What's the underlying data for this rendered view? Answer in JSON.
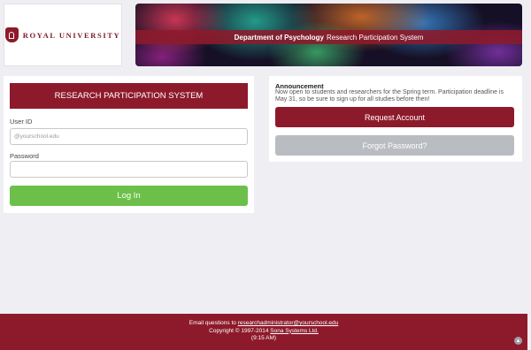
{
  "brand": {
    "logo_text": "ROYAL UNIVERSITY",
    "colors": {
      "primary": "#8d1a2b",
      "success": "#6cc04a",
      "muted": "#b9bcc1"
    }
  },
  "banner": {
    "department": "Department of Psychology",
    "system": "Research Participation System"
  },
  "login": {
    "header": "RESEARCH PARTICIPATION SYSTEM",
    "user_id_label": "User ID",
    "user_id_placeholder": "@yourschool.edu",
    "user_id_value": "",
    "password_label": "Password",
    "password_value": "",
    "login_button": "Log In"
  },
  "announcement": {
    "title": "Announcement",
    "body": "Now open to students and researchers for the Spring term. Participation deadline is May 31, so be sure to sign up for all studies before then!",
    "request_button": "Request Account",
    "forgot_button": "Forgot Password?"
  },
  "footer": {
    "email_prefix": "Email questions to ",
    "email": "researchadministrator@yourschool.edu",
    "copyright_prefix": "Copyright © 1997-2014 ",
    "company": "Sona Systems Ltd.",
    "time": "(9:15 AM)"
  },
  "icons": {
    "scroll_top": "chevron-up-icon",
    "logo": "shield-icon"
  }
}
